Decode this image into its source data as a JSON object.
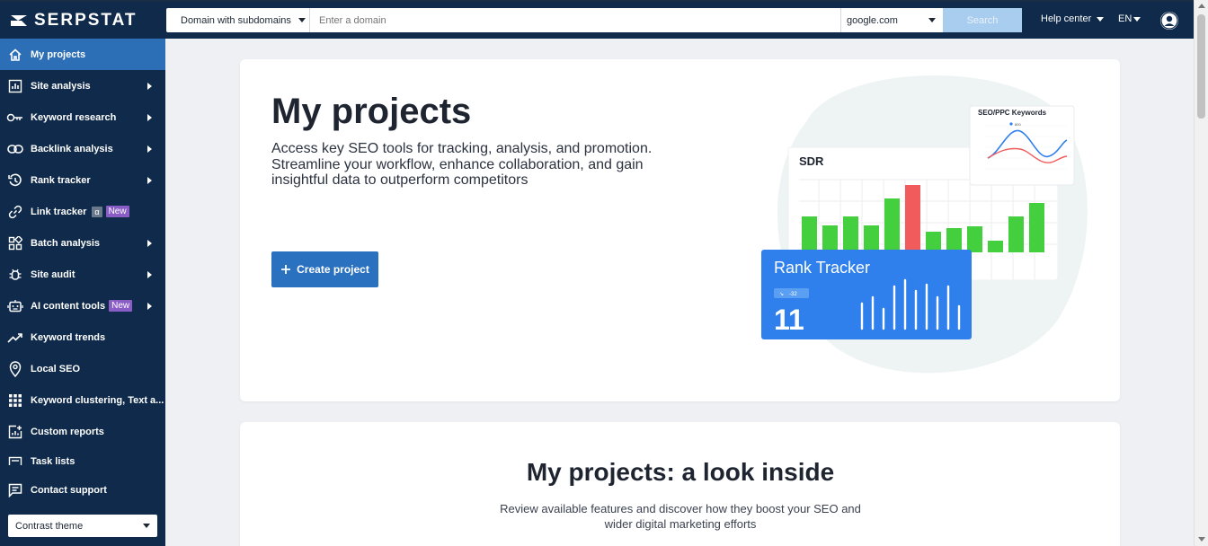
{
  "brand": {
    "name": "SERPSTAT"
  },
  "search": {
    "scope": "Domain with subdomains",
    "placeholder": "Enter a domain",
    "database": "google.com",
    "button": "Search"
  },
  "header": {
    "help": "Help center",
    "lang": "EN"
  },
  "sidebar": {
    "items": [
      {
        "label": "My projects"
      },
      {
        "label": "Site analysis"
      },
      {
        "label": "Keyword research"
      },
      {
        "label": "Backlink analysis"
      },
      {
        "label": "Rank tracker"
      },
      {
        "label": "Link tracker",
        "alpha": "α",
        "badge": "New"
      },
      {
        "label": "Batch analysis"
      },
      {
        "label": "Site audit"
      },
      {
        "label": "AI content tools",
        "badge": "New"
      },
      {
        "label": "Keyword trends"
      },
      {
        "label": "Local SEO"
      },
      {
        "label": "Keyword clustering, Text a..."
      },
      {
        "label": "Custom reports"
      },
      {
        "label": "Task lists"
      }
    ],
    "support": "Contact support",
    "theme": "Contrast theme"
  },
  "hero": {
    "title": "My projects",
    "description": "Access key SEO tools for tracking, analysis, and promotion. Streamline your workflow, enhance collaboration, and gain insightful data to outperform competitors",
    "create_button": "Create project",
    "illustration": {
      "keywords_card_title": "SEO/PPC Keywords",
      "keywords_point_label": "800",
      "sdr_title": "SDR",
      "rank_title": "Rank Tracker",
      "rank_change": "-32",
      "rank_value": "11",
      "colors": {
        "green": "#44cf3f",
        "red": "#f15b5b",
        "blue": "#2f80ed"
      }
    }
  },
  "inside": {
    "title": "My projects: a look inside",
    "description": "Review available features and discover how they boost your SEO and wider digital marketing efforts"
  },
  "colors": {
    "nav_bg": "#0f2a4a",
    "active": "#2c6fb7",
    "accent": "#2a71c0",
    "badge_new": "#8a5cc6"
  }
}
